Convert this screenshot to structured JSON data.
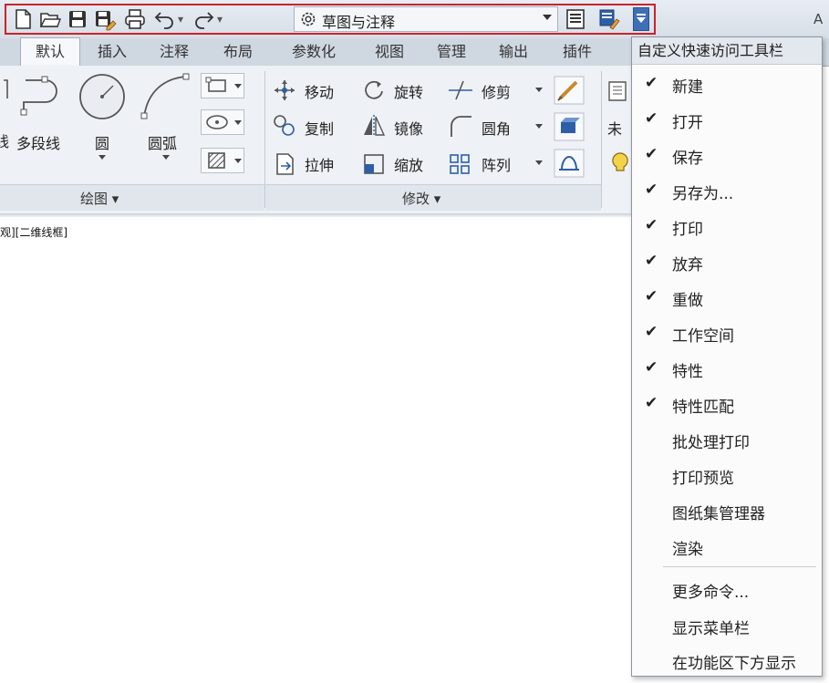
{
  "qat": {
    "workspace": "草图与注释",
    "icons": [
      "new-icon",
      "open-icon",
      "save-icon",
      "save-as-icon",
      "print-icon",
      "undo-icon",
      "redo-icon"
    ],
    "title_hint": "A"
  },
  "tabs": [
    {
      "label": "默认",
      "active": true
    },
    {
      "label": "插入",
      "active": false
    },
    {
      "label": "注释",
      "active": false
    },
    {
      "label": "布局",
      "active": false
    },
    {
      "label": "参数化",
      "active": false
    },
    {
      "label": "视图",
      "active": false
    },
    {
      "label": "管理",
      "active": false
    },
    {
      "label": "输出",
      "active": false
    },
    {
      "label": "插件",
      "active": false
    }
  ],
  "ribbon": {
    "draw": {
      "cut_label": "线",
      "polyline": "多段线",
      "circle": "圆",
      "arc": "圆弧",
      "footer": "绘图 ▾"
    },
    "modify": {
      "move": "移动",
      "rotate": "旋转",
      "trim": "修剪",
      "copy": "复制",
      "mirror": "镜像",
      "fillet": "圆角",
      "stretch": "拉伸",
      "scale": "缩放",
      "array": "阵列",
      "footer": "修改 ▾"
    },
    "layer": {
      "cut_label": "未"
    }
  },
  "viewport_label": "观][二维线框]",
  "menu": {
    "title": "自定义快速访问工具栏",
    "items": [
      {
        "label": "新建",
        "checked": true
      },
      {
        "label": "打开",
        "checked": true
      },
      {
        "label": "保存",
        "checked": true
      },
      {
        "label": "另存为...",
        "checked": true
      },
      {
        "label": "打印",
        "checked": true
      },
      {
        "label": "放弃",
        "checked": true
      },
      {
        "label": "重做",
        "checked": true
      },
      {
        "label": "工作空间",
        "checked": true
      },
      {
        "label": "特性",
        "checked": true
      },
      {
        "label": "特性匹配",
        "checked": true
      },
      {
        "label": "批处理打印",
        "checked": false
      },
      {
        "label": "打印预览",
        "checked": false
      },
      {
        "label": "图纸集管理器",
        "checked": false
      },
      {
        "label": "渲染",
        "checked": false
      }
    ],
    "extra": [
      {
        "label": "更多命令..."
      },
      {
        "label": "显示菜单栏"
      },
      {
        "label": "在功能区下方显示"
      }
    ],
    "check_glyph": "✔"
  }
}
